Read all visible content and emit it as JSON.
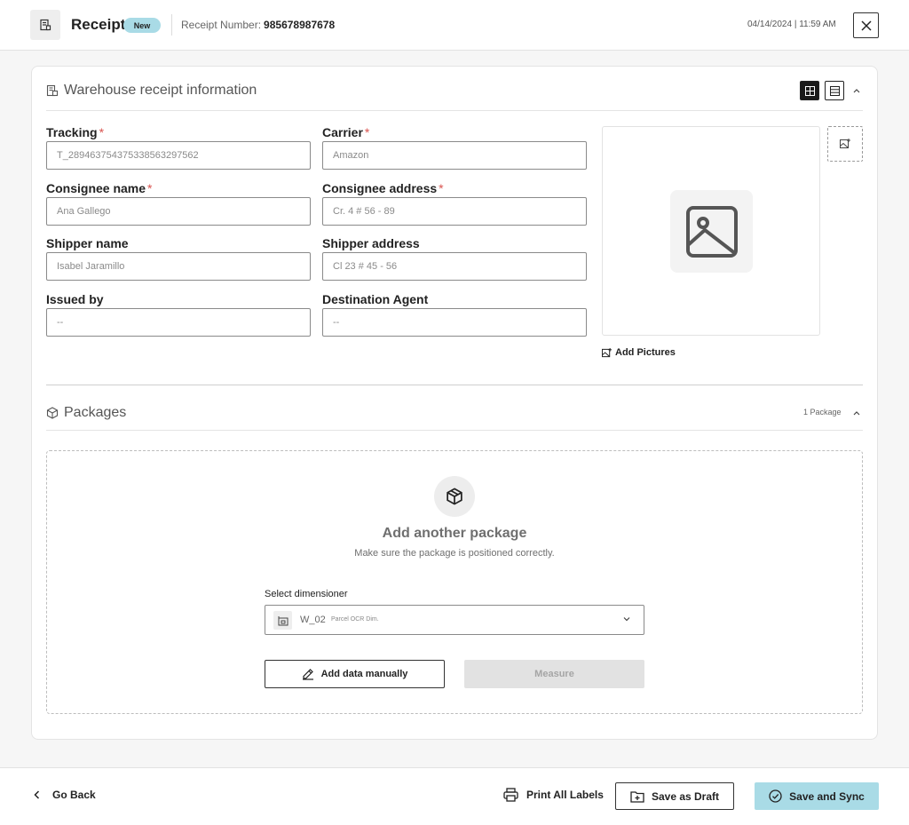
{
  "header": {
    "title": "Receipt",
    "badge": "New",
    "receipt_label": "Receipt Number:",
    "receipt_number": "985678987678",
    "datetime": "04/14/2024 | 11:59 AM"
  },
  "warehouse": {
    "title": "Warehouse receipt information",
    "fields": {
      "tracking": {
        "label": "Tracking",
        "placeholder": "T_289463754375338563297562",
        "required": true
      },
      "carrier": {
        "label": "Carrier",
        "placeholder": "Amazon",
        "required": true
      },
      "consignee_name": {
        "label": "Consignee name",
        "placeholder": "Ana Gallego",
        "required": true
      },
      "consignee_address": {
        "label": "Consignee address",
        "placeholder": "Cr. 4 # 56 - 89",
        "required": true
      },
      "shipper_name": {
        "label": "Shipper name",
        "placeholder": "Isabel Jaramillo",
        "required": false
      },
      "shipper_address": {
        "label": "Shipper address",
        "placeholder": "Cl 23 # 45 - 56",
        "required": false
      },
      "issued_by": {
        "label": "Issued by",
        "placeholder": "--",
        "required": false
      },
      "destination_agent": {
        "label": "Destination Agent",
        "placeholder": "--",
        "required": false
      }
    },
    "required_mark": "*",
    "add_pictures": "Add Pictures"
  },
  "packages": {
    "title": "Packages",
    "count": "1 Package",
    "add_heading": "Add another package",
    "add_sub": "Make sure the package is positioned correctly.",
    "dimensioner_label": "Select dimensioner",
    "dimensioner_name": "W_02",
    "dimensioner_type": "Parcel OCR Dim.",
    "add_manual": "Add data manually",
    "measure": "Measure"
  },
  "footer": {
    "go_back": "Go Back",
    "print_labels": "Print All Labels",
    "save_draft": "Save as Draft",
    "save_sync": "Save and Sync"
  },
  "colors": {
    "accent": "#a9dbe6",
    "required": "#d9534f",
    "disabled_bg": "#e2e2e2"
  },
  "icons": [
    "receipt-icon",
    "close-icon",
    "warehouse-icon",
    "grid-view-icon",
    "list-view-icon",
    "chevron-up-icon",
    "add-image-icon",
    "image-placeholder-icon",
    "package-icon",
    "dimensioner-icon",
    "chevron-down-icon",
    "pencil-icon",
    "chevron-left-icon",
    "printer-icon",
    "folder-plus-icon",
    "check-circle-icon"
  ]
}
